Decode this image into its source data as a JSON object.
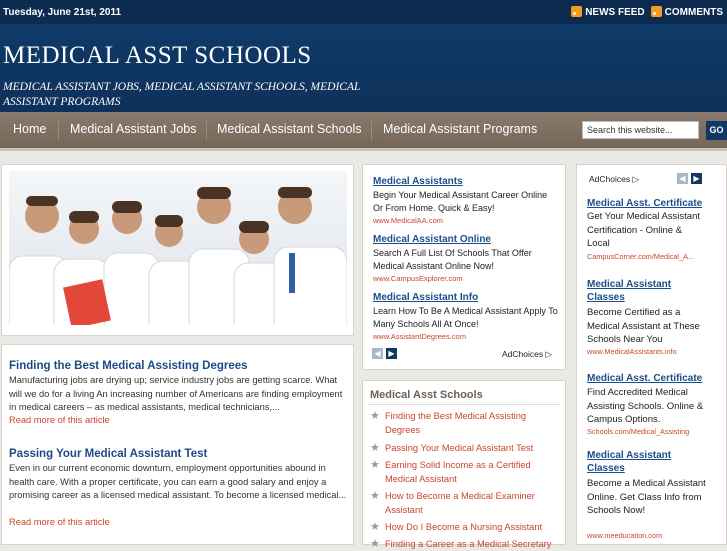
{
  "topbar": {
    "date": "Tuesday, June 21st, 2011",
    "news_feed": "NEWS FEED",
    "comments": "COMMENTS"
  },
  "header": {
    "title": "MEDICAL ASST SCHOOLS",
    "tagline": "MEDICAL ASSISTANT JOBS, MEDICAL ASSISTANT SCHOOLS, MEDICAL ASSISTANT PROGRAMS"
  },
  "nav": {
    "items": [
      "Home",
      "Medical Assistant Jobs",
      "Medical Assistant Schools",
      "Medical Assistant Programs"
    ]
  },
  "search": {
    "placeholder": "Search this website...",
    "go": "GO"
  },
  "posts": [
    {
      "title": "Finding the Best Medical Assisting Degrees",
      "excerpt": "Manufacturing jobs are drying up; service industry jobs are getting scarce. What will we do for a living An increasing number of Americans are finding employment in medical careers – as medical assistants, medical technicians,...",
      "read_more": "Read more of this article"
    },
    {
      "title": "Passing Your Medical Assistant Test",
      "excerpt": "Even in our current economic downturn, employment opportunities abound in health care. With a proper certificate, you can earn a good salary and enjoy a promising career as a licensed medical assistant. To become a licensed medical...",
      "read_more": "Read more of this article"
    }
  ],
  "ads_middle": {
    "items": [
      {
        "title": "Medical Assistants",
        "body": "Begin Your Medical Assistant Career Online Or From Home. Quick & Easy!",
        "url": "www.MedicalAA.com"
      },
      {
        "title": "Medical Assistant Online",
        "body": "Search A Full List Of Schools That Offer Medical Assistant Online Now!",
        "url": "www.CampusExplorer.com"
      },
      {
        "title": "Medical Assistant Info",
        "body": "Learn How To Be A Medical Assistant Apply To Many Schools All At Once!",
        "url": "www.AssistantDegrees.com"
      }
    ],
    "adchoices": "AdChoices"
  },
  "sidebar_list": {
    "heading": "Medical Asst Schools",
    "items": [
      "Finding the Best Medical Assisting Degrees",
      "Passing Your Medical Assistant Test",
      "Earning Solid Income as a Certified Medical Assistant",
      "How to Become a Medical Examiner Assistant",
      "How Do I Become a Nursing Assistant",
      "Finding a Career as a Medical Secretary"
    ]
  },
  "ads_right": {
    "adchoices": "AdChoices",
    "items": [
      {
        "title": "Medical Asst. Certificate",
        "body": "Get Your Medical Assistant Certification - Online & Local",
        "url": "CampusCorner.com/Medical_A..."
      },
      {
        "title": "Medical Assistant Classes",
        "body": "Become Certified as a Medical Assistant at These Schools Near You",
        "url": "www.MedicalAssistants.info"
      },
      {
        "title": "Medical Asst. Certificate",
        "body": "Find Accredited Medical Assisting Schools. Online & Campus Options.",
        "url": "Schools.com/Medical_Assisting"
      },
      {
        "title": "Medical Assistant Classes",
        "body": "Become a Medical Assistant Online. Get Class Info from Schools Now!",
        "url": "www.meeducation.com"
      }
    ]
  },
  "colors": {
    "header": "#0d3159",
    "nav": "#7d6d60",
    "link": "#1c4e8a",
    "accent": "#c9462a"
  }
}
